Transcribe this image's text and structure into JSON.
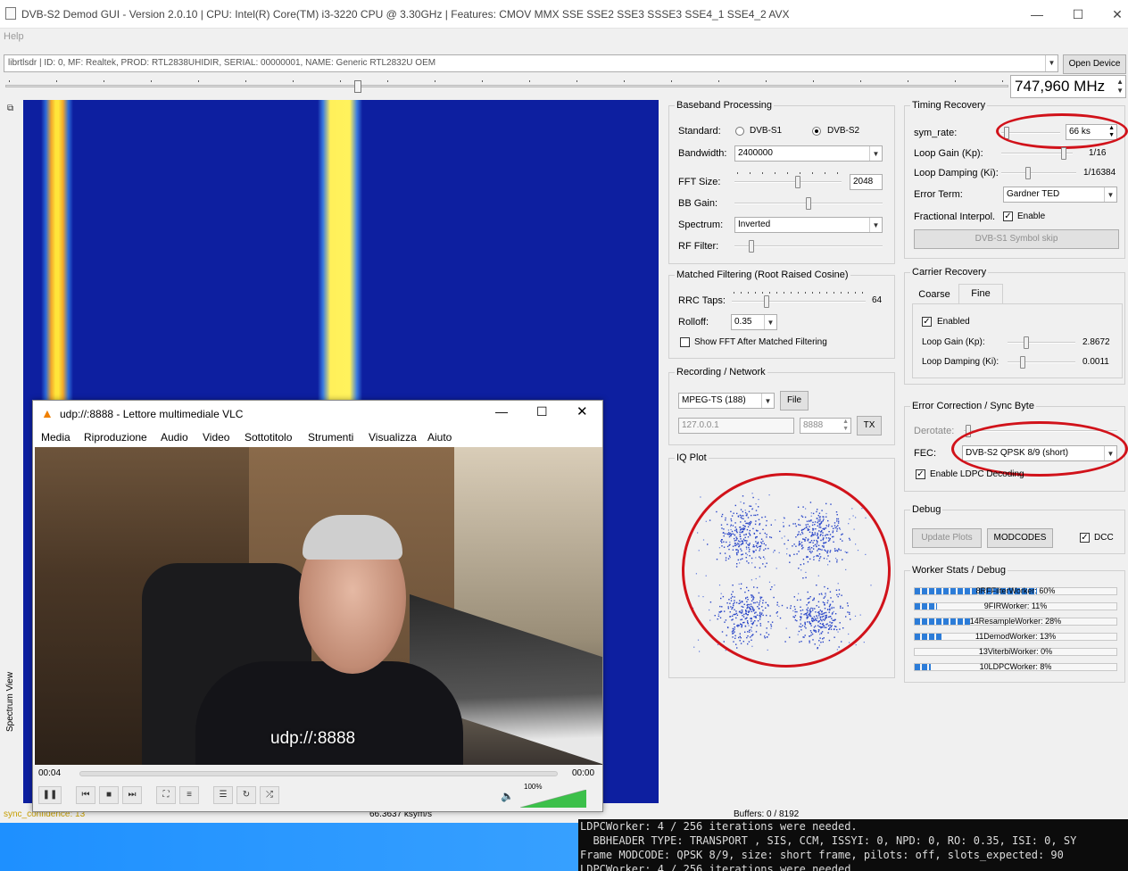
{
  "window": {
    "title": "DVB-S2 Demod GUI - Version 2.0.10 | CPU:        Intel(R) Core(TM) i3-3220 CPU @ 3.30GHz | Features: CMOV MMX SSE SSE2 SSE3 SSSE3 SSE4_1 SSE4_2 AVX",
    "min": "—",
    "max": "☐",
    "close": "✕"
  },
  "menu": {
    "help": "Help"
  },
  "device": {
    "selected": "librtlsdr | ID: 0, MF: Realtek, PROD: RTL2838UHIDIR, SERIAL: 00000001, NAME: Generic RTL2832U OEM",
    "open_button": "Open Device"
  },
  "frequency": {
    "value": "747,960 MHz",
    "slider_position": 0.35
  },
  "baseband": {
    "title": "Baseband Processing",
    "standard_label": "Standard:",
    "options": [
      "DVB-S1",
      "DVB-S2"
    ],
    "selected": "DVB-S2",
    "bandwidth_label": "Bandwidth:",
    "bandwidth_value": "2400000",
    "fft_label": "FFT Size:",
    "fft_value": "2048",
    "fft_slider": 0.6,
    "bbgain_label": "BB Gain:",
    "bbgain_slider": 0.5,
    "spectrum_label": "Spectrum:",
    "spectrum_value": "Inverted",
    "rffilter_label": "RF Filter:",
    "rffilter_slider": 0.1
  },
  "matched": {
    "title": "Matched Filtering (Root Raised Cosine)",
    "rrc_label": "RRC Taps:",
    "rrc_value": "64",
    "rrc_slider": 0.25,
    "rolloff_label": "Rolloff:",
    "rolloff_value": "0.35",
    "showfft_label": "Show FFT After Matched Filtering"
  },
  "recording": {
    "title": "Recording / Network",
    "format": "MPEG-TS (188)",
    "file_button": "File",
    "ip": "127.0.0.1",
    "port": "8888",
    "tx_button": "TX"
  },
  "iq": {
    "title": "IQ Plot"
  },
  "timing": {
    "title": "Timing Recovery",
    "symrate_label": "sym_rate:",
    "symrate_value": "66 ks",
    "symrate_slider": 0.05,
    "loopgain_label": "Loop Gain (Kp):",
    "loopgain_value": "1/16",
    "loopgain_slider": 0.9,
    "loopdamp_label": "Loop Damping (Ki):",
    "loopdamp_value": "1/16384",
    "loopdamp_slider": 0.35,
    "errterm_label": "Error Term:",
    "errterm_value": "Gardner TED",
    "frac_label": "Fractional Interpol.",
    "frac_enable": "Enable",
    "symskip_button": "DVB-S1 Symbol skip"
  },
  "carrier": {
    "title": "Carrier Recovery",
    "tabs": [
      "Coarse",
      "Fine"
    ],
    "active_tab": "Fine",
    "enabled_label": "Enabled",
    "loopgain_label": "Loop Gain (Kp):",
    "loopgain_value": "2.8672",
    "loopgain_slider": 0.25,
    "loopdamp_label": "Loop Damping (Ki):",
    "loopdamp_value": "0.0011",
    "loopdamp_slider": 0.2
  },
  "errorcorr": {
    "title": "Error Correction / Sync Byte",
    "derotate_label": "Derotate:",
    "fec_label": "FEC:",
    "fec_value": "DVB-S2 QPSK 8/9 (short)",
    "ldpc_label": "Enable LDPC Decoding"
  },
  "debug": {
    "title": "Debug",
    "update_button": "Update Plots",
    "modcodes_button": "MODCODES",
    "dcc_label": "DCC"
  },
  "workers": {
    "title": "Worker Stats / Debug",
    "items": [
      {
        "label": "8RFFilterWorker: 60%",
        "pct": 60
      },
      {
        "label": "9FIRWorker: 11%",
        "pct": 11
      },
      {
        "label": "14ResampleWorker: 28%",
        "pct": 28
      },
      {
        "label": "11DemodWorker: 13%",
        "pct": 13
      },
      {
        "label": "13ViterbiWorker: 0%",
        "pct": 0
      },
      {
        "label": "10LDPCWorker: 8%",
        "pct": 8
      }
    ]
  },
  "status": {
    "sync": "sync_confidence: 13",
    "symrate": "66.3637 ksym/s",
    "buffers": "Buffers: 0 / 8192"
  },
  "spectrum_view_label": "Spectrum View",
  "vlc": {
    "title": "udp://:8888 - Lettore multimediale VLC",
    "menu": [
      "Media",
      "Riproduzione",
      "Audio",
      "Video",
      "Sottotitolo",
      "Strumenti",
      "Visualizza",
      "Aiuto"
    ],
    "overlay": "udp://:8888",
    "time_elapsed": "00:04",
    "time_total": "00:00",
    "volume": "100%",
    "volume_level": 1.0
  },
  "console": {
    "lines": [
      "LDPCWorker: 4 / 256 iterations were needed.",
      "  BBHEADER TYPE: TRANSPORT , SIS, CCM, ISSYI: 0, NPD: 0, RO: 0.35, ISI: 0, SY",
      "Frame MODCODE: QPSK 8/9, size: short frame, pilots: off, slots_expected: 90",
      "LDPCWorker: 4 / 256 iterations were needed."
    ]
  },
  "colors": {
    "waterfall_bg": "#0d1fa0",
    "highlight": "#d1121a",
    "accent": "#2c7cd8"
  }
}
